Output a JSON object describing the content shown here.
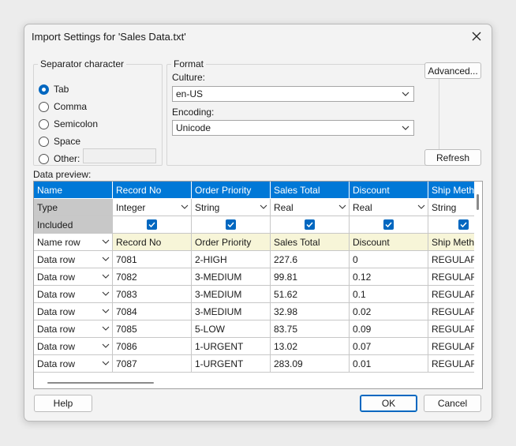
{
  "window": {
    "title": "Import Settings for 'Sales Data.txt'",
    "close_glyph": "✕"
  },
  "separator": {
    "legend": "Separator character",
    "options": [
      {
        "label": "Tab",
        "selected": true
      },
      {
        "label": "Comma",
        "selected": false
      },
      {
        "label": "Semicolon",
        "selected": false
      },
      {
        "label": "Space",
        "selected": false
      },
      {
        "label": "Other:",
        "selected": false
      }
    ],
    "other_value": ""
  },
  "format": {
    "legend": "Format",
    "culture_label": "Culture:",
    "culture_value": "en-US",
    "encoding_label": "Encoding:",
    "encoding_value": "Unicode"
  },
  "buttons": {
    "advanced": "Advanced...",
    "refresh": "Refresh",
    "help": "Help",
    "ok": "OK",
    "cancel": "Cancel"
  },
  "preview": {
    "label": "Data preview:",
    "header": [
      "Name",
      "Record No",
      "Order Priority",
      "Sales Total",
      "Discount",
      "Ship Meth"
    ],
    "type_row": [
      "Type",
      "Integer",
      "String",
      "Real",
      "Real",
      "String"
    ],
    "included_row": {
      "label": "Included",
      "checks": [
        true,
        true,
        true,
        true,
        true
      ]
    },
    "name_row": [
      "Name row",
      "Record No",
      "Order Priority",
      "Sales Total",
      "Discount",
      "Ship Meth"
    ],
    "data_rows": [
      [
        "Data row",
        "7081",
        "2-HIGH",
        "227.6",
        "0",
        "REGULAR"
      ],
      [
        "Data row",
        "7082",
        "3-MEDIUM",
        "99.81",
        "0.12",
        "REGULAR"
      ],
      [
        "Data row",
        "7083",
        "3-MEDIUM",
        "51.62",
        "0.1",
        "REGULAR"
      ],
      [
        "Data row",
        "7084",
        "3-MEDIUM",
        "32.98",
        "0.02",
        "REGULAR"
      ],
      [
        "Data row",
        "7085",
        "5-LOW",
        "83.75",
        "0.09",
        "REGULAR"
      ],
      [
        "Data row",
        "7086",
        "1-URGENT",
        "13.02",
        "0.07",
        "REGULAR"
      ],
      [
        "Data row",
        "7087",
        "1-URGENT",
        "283.09",
        "0.01",
        "REGULAR"
      ]
    ]
  },
  "colors": {
    "accent": "#0067c0",
    "header_bg": "#0078d7",
    "name_row_bg": "#f7f5d8"
  }
}
